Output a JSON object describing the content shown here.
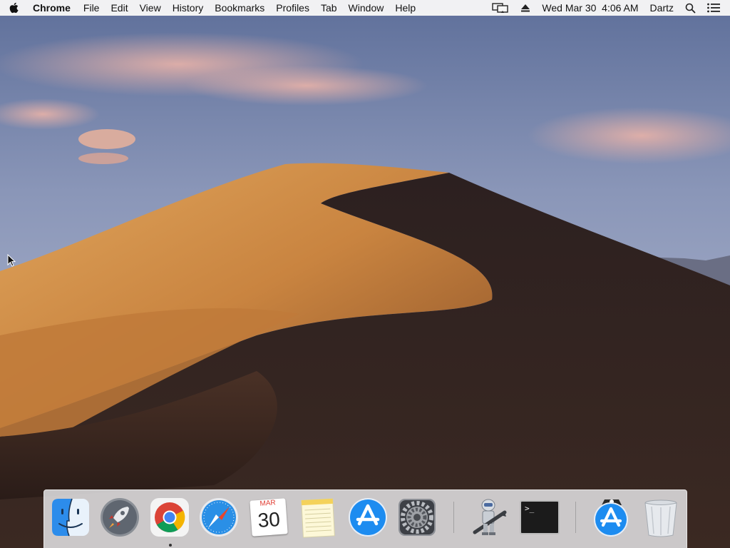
{
  "menubar": {
    "app_name": "Chrome",
    "menus": [
      "File",
      "Edit",
      "View",
      "History",
      "Bookmarks",
      "Profiles",
      "Tab",
      "Window",
      "Help"
    ],
    "clock": "Wed Mar 30  4:06 AM",
    "user": "Dartz",
    "icons": [
      "apple-icon",
      "display-mirroring-icon",
      "eject-icon",
      "spotlight-search-icon",
      "notification-center-icon"
    ]
  },
  "dock": {
    "apps": [
      {
        "name": "Finder",
        "icon": "finder-icon"
      },
      {
        "name": "Launchpad",
        "icon": "launchpad-rocket-icon"
      },
      {
        "name": "Google Chrome",
        "icon": "chrome-icon",
        "running": true
      },
      {
        "name": "Safari",
        "icon": "safari-compass-icon"
      },
      {
        "name": "Calendar",
        "icon": "calendar-icon",
        "month": "MAR",
        "day": "30"
      },
      {
        "name": "Notes",
        "icon": "notes-icon"
      },
      {
        "name": "App Store",
        "icon": "app-store-icon"
      },
      {
        "name": "System Preferences",
        "icon": "system-preferences-gear-icon"
      },
      {
        "name": "Automator",
        "icon": "automator-robot-icon"
      },
      {
        "name": "Terminal",
        "icon": "terminal-icon",
        "prompt": ">_"
      },
      {
        "name": "App Store Installer",
        "icon": "app-store-installer-icon"
      },
      {
        "name": "Trash",
        "icon": "trash-icon"
      }
    ]
  },
  "colors": {
    "menubar_bg": "#f6f6f6",
    "sky_top": "#6f7fa6",
    "dune_light": "#d79a4e",
    "dune_shadow": "#3a2a24",
    "chrome_red": "#db4437",
    "chrome_green": "#0f9d58",
    "chrome_yellow": "#f4b400",
    "chrome_blue": "#4285f4",
    "app_store_blue": "#1d8cf0"
  }
}
